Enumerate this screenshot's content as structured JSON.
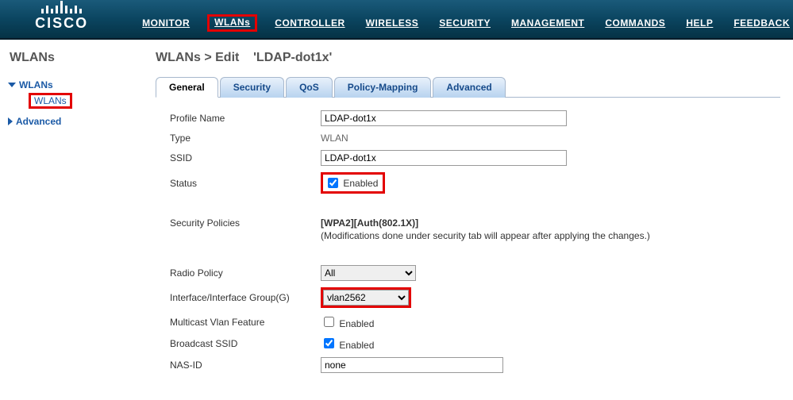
{
  "brand": "CISCO",
  "topnav": {
    "monitor": "MONITOR",
    "wlans": "WLANs",
    "controller": "CONTROLLER",
    "wireless": "WIRELESS",
    "security": "SECURITY",
    "management": "MANAGEMENT",
    "commands": "COMMANDS",
    "help": "HELP",
    "feedback": "FEEDBACK"
  },
  "sidebar": {
    "title": "WLANs",
    "items": {
      "wlans": "WLANs",
      "wlans_sub": "WLANs",
      "advanced": "Advanced"
    }
  },
  "breadcrumb": {
    "root": "WLANs",
    "action": "Edit",
    "name": "'LDAP-dot1x'"
  },
  "tabs": {
    "general": "General",
    "security": "Security",
    "qos": "QoS",
    "policy": "Policy-Mapping",
    "advanced": "Advanced"
  },
  "form": {
    "profile_name_label": "Profile Name",
    "profile_name_value": "LDAP-dot1x",
    "type_label": "Type",
    "type_value": "WLAN",
    "ssid_label": "SSID",
    "ssid_value": "LDAP-dot1x",
    "status_label": "Status",
    "status_checkbox_label": "Enabled",
    "status_checked": true,
    "secpol_label": "Security Policies",
    "secpol_value": "[WPA2][Auth(802.1X)]",
    "secpol_note": "(Modifications done under security tab will appear after applying the changes.)",
    "radio_label": "Radio Policy",
    "radio_value": "All",
    "iface_label": "Interface/Interface Group(G)",
    "iface_value": "vlan2562",
    "mcast_label": "Multicast Vlan Feature",
    "mcast_checkbox_label": "Enabled",
    "mcast_checked": false,
    "bcast_label": "Broadcast SSID",
    "bcast_checkbox_label": "Enabled",
    "bcast_checked": true,
    "nasid_label": "NAS-ID",
    "nasid_value": "none"
  }
}
